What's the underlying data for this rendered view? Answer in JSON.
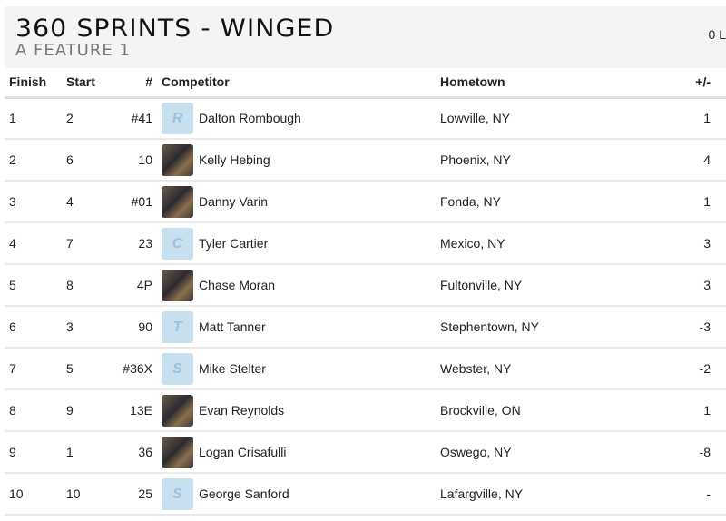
{
  "header": {
    "title": "360 SPRINTS - WINGED",
    "subtitle": "A FEATURE 1",
    "laps": "0 L"
  },
  "columns": {
    "finish": "Finish",
    "start": "Start",
    "number": "#",
    "competitor": "Competitor",
    "hometown": "Hometown",
    "diff": "+/-"
  },
  "rows": [
    {
      "finish": "1",
      "start": "2",
      "number": "#41",
      "avatar": "R",
      "name": "Dalton Rombough",
      "hometown": "Lowville, NY",
      "diff": "1"
    },
    {
      "finish": "2",
      "start": "6",
      "number": "10",
      "avatar": "photo",
      "name": "Kelly Hebing",
      "hometown": "Phoenix, NY",
      "diff": "4"
    },
    {
      "finish": "3",
      "start": "4",
      "number": "#01",
      "avatar": "photo",
      "name": "Danny Varin",
      "hometown": "Fonda, NY",
      "diff": "1"
    },
    {
      "finish": "4",
      "start": "7",
      "number": "23",
      "avatar": "C",
      "name": "Tyler Cartier",
      "hometown": "Mexico, NY",
      "diff": "3"
    },
    {
      "finish": "5",
      "start": "8",
      "number": "4P",
      "avatar": "photo",
      "name": "Chase Moran",
      "hometown": "Fultonville, NY",
      "diff": "3"
    },
    {
      "finish": "6",
      "start": "3",
      "number": "90",
      "avatar": "T",
      "name": "Matt Tanner",
      "hometown": "Stephentown, NY",
      "diff": "-3"
    },
    {
      "finish": "7",
      "start": "5",
      "number": "#36X",
      "avatar": "S",
      "name": "Mike Stelter",
      "hometown": "Webster, NY",
      "diff": "-2"
    },
    {
      "finish": "8",
      "start": "9",
      "number": "13E",
      "avatar": "photo",
      "name": "Evan Reynolds",
      "hometown": "Brockville, ON",
      "diff": "1"
    },
    {
      "finish": "9",
      "start": "1",
      "number": "36",
      "avatar": "photo",
      "name": "Logan Crisafulli",
      "hometown": "Oswego, NY",
      "diff": "-8"
    },
    {
      "finish": "10",
      "start": "10",
      "number": "25",
      "avatar": "S",
      "name": "George Sanford",
      "hometown": "Lafargville, NY",
      "diff": "-"
    }
  ]
}
